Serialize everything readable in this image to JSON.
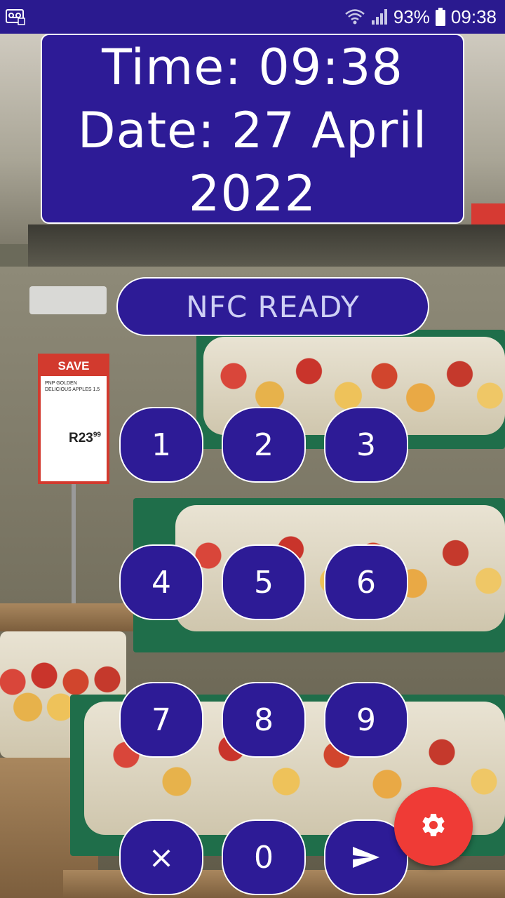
{
  "status_bar": {
    "notification_icon": "voicemail-icon",
    "wifi_icon": "wifi-icon",
    "signal_icon": "signal-icon",
    "battery_percent": "93%",
    "battery_icon": "battery-icon",
    "time": "09:38"
  },
  "clock": {
    "time_line": "Time: 09:38",
    "date_line": "Date: 27 April",
    "year_line": "2022"
  },
  "nfc": {
    "status": "NFC READY"
  },
  "keypad": {
    "k1": "1",
    "k2": "2",
    "k3": "3",
    "k4": "4",
    "k5": "5",
    "k6": "6",
    "k7": "7",
    "k8": "8",
    "k9": "9",
    "clear": "×",
    "k0": "0",
    "submit_icon": "send-icon"
  },
  "fab": {
    "icon": "gear-icon"
  },
  "background": {
    "sign_header": "SAVE",
    "sign_small": "PNP GOLDEN DELICIOUS APPLES 1.5",
    "sign_price": "R23",
    "sign_cents": "99"
  },
  "colors": {
    "primary": "#2d1b96",
    "status_bar": "#2a1a8f",
    "fab": "#ef3b36",
    "text": "#ffffff"
  }
}
